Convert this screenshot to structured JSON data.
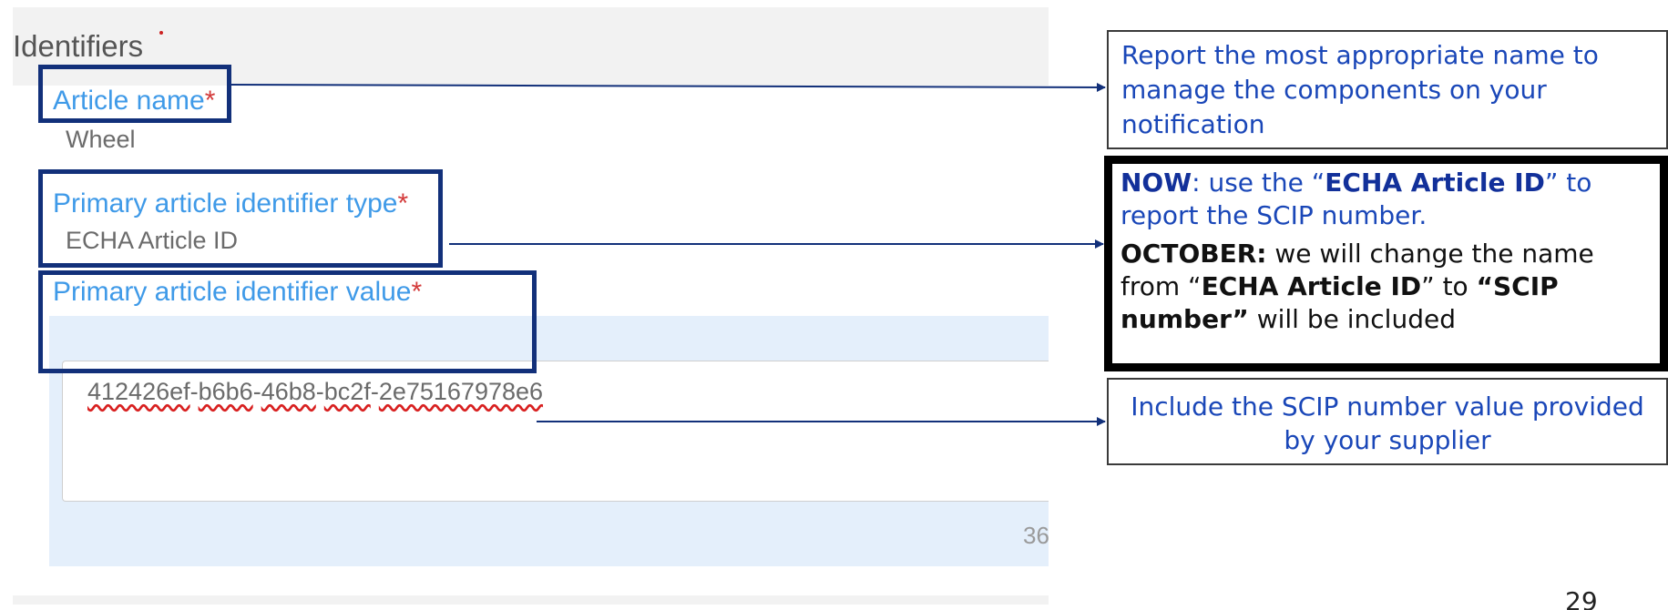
{
  "form": {
    "section_title": "Identifiers",
    "required_marker": "*",
    "article_name": {
      "label": "Article name",
      "value": "Wheel"
    },
    "primary_identifier_type": {
      "label": "Primary article identifier type",
      "value": "ECHA Article ID"
    },
    "primary_identifier_value": {
      "label": "Primary article identifier value",
      "value_parts": [
        "412426ef",
        "-",
        "b6b6",
        "-",
        "46b8",
        "-",
        "bc2f",
        "-",
        "2e75167978e6"
      ],
      "char_count": "36"
    }
  },
  "callouts": {
    "article_name_note": "Report the most appropriate name to manage the components on your notification",
    "identifier_type_note": {
      "now_keyword": "NOW",
      "now_text_1": ": use the “",
      "now_bold": "ECHA Article ID",
      "now_text_2": "” to report the SCIP number.",
      "october_keyword": "OCTOBER:",
      "october_text_1": " we will change the name from “",
      "october_bold_1": "ECHA Article ID",
      "october_text_2": "”  to ",
      "october_bold_2": "“SCIP number”",
      "october_text_3": " will be included"
    },
    "identifier_value_note": "Include the SCIP number value provided by your supplier"
  },
  "page_number": "29",
  "colors": {
    "label_blue": "#3f9ae8",
    "required_red": "#d33a3a",
    "highlight_navy": "#12307a",
    "callout_blue": "#1a47b8"
  }
}
